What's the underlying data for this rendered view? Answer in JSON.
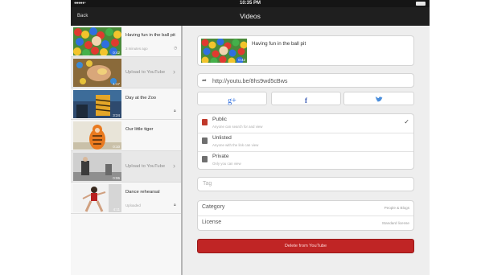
{
  "status_bar": {
    "time": "10:35 PM"
  },
  "nav": {
    "back_label": "Back",
    "title": "Videos"
  },
  "sidebar": {
    "items": [
      {
        "title": "Having fun in the ball pit",
        "subtitle": "3 minutes ago",
        "duration": "0:42",
        "status_icon": "clock-icon"
      },
      {
        "title": "Upload to YouTube",
        "subtitle": "",
        "duration": "1:17",
        "status_icon": "chevron-right-icon"
      },
      {
        "title": "Day at the Zoo",
        "subtitle": "",
        "duration": "3:24",
        "status_icon": "lock-icon"
      },
      {
        "title": "Our little tiger",
        "subtitle": "",
        "duration": "0:10",
        "status_icon": ""
      },
      {
        "title": "Upload to YouTube",
        "subtitle": "",
        "duration": "0:06",
        "status_icon": "chevron-right-icon"
      },
      {
        "title": "Dance rehearsal",
        "subtitle": "Uploaded",
        "duration": "4:11",
        "status_icon": "lock-icon"
      }
    ]
  },
  "detail": {
    "video_title": "Having fun in the ball pit",
    "video_duration": "0:42",
    "url": "http://youtu.be/8hs9wd5cBws",
    "share": {
      "google_plus": "g+",
      "facebook": "f",
      "twitter": "twitter-bird-icon"
    },
    "privacy": [
      {
        "label": "Public",
        "description": "Anyone can search for and view",
        "selected": true,
        "icon": "globe-icon"
      },
      {
        "label": "Unlisted",
        "description": "Anyone with the link can view",
        "selected": false,
        "icon": "lock-icon"
      },
      {
        "label": "Private",
        "description": "Only you can view",
        "selected": false,
        "icon": "lock-icon"
      }
    ],
    "tag_placeholder": "Tag",
    "category_label": "Category",
    "category_value": "People & Blogs",
    "license_label": "License",
    "license_value": "Standard license",
    "delete_label": "Delete from YouTube"
  },
  "colors": {
    "delete_red": "#c02525",
    "nav_dark": "#1f1f1f",
    "public_red": "#c0392b"
  }
}
